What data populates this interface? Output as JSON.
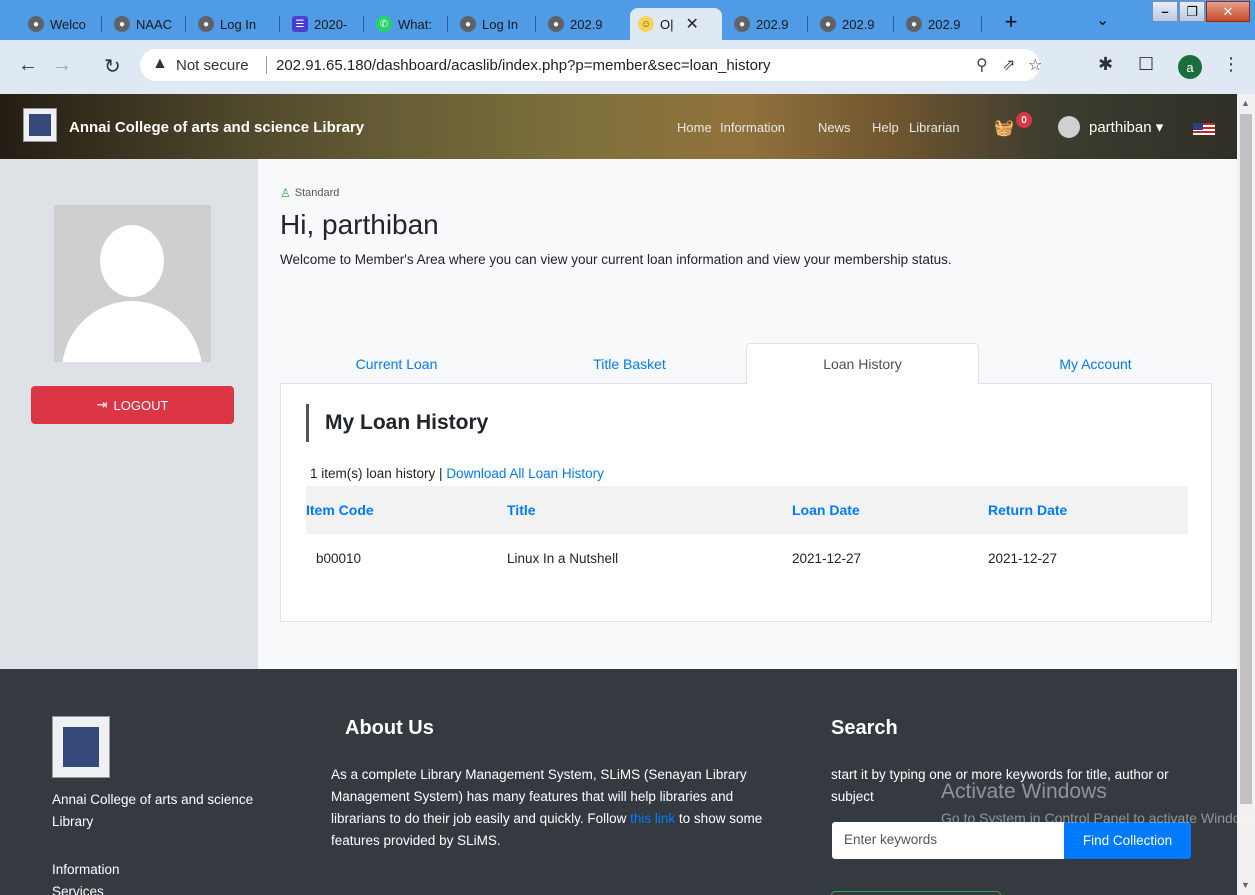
{
  "browser": {
    "tabs": [
      {
        "label": "Welco",
        "icon": "globe-icon"
      },
      {
        "label": "NAAC",
        "icon": "globe-icon"
      },
      {
        "label": "Log In",
        "icon": "globe-icon"
      },
      {
        "label": "2020-",
        "icon": "sheet-icon"
      },
      {
        "label": "What:",
        "icon": "whatsapp-icon"
      },
      {
        "label": "Log In",
        "icon": "globe-icon"
      },
      {
        "label": "202.9",
        "icon": "globe-icon"
      },
      {
        "label": "O|",
        "icon": "smile-icon"
      },
      {
        "label": "202.9",
        "icon": "globe-icon"
      },
      {
        "label": "202.9",
        "icon": "globe-icon"
      },
      {
        "label": "202.9",
        "icon": "globe-icon"
      }
    ],
    "security_label": "Not secure",
    "url": "202.91.65.180/dashboard/acaslib/index.php?p=member&sec=loan_history",
    "profile_initial": "a"
  },
  "header": {
    "brand": "Annai College of arts and science Library",
    "nav": [
      "Home",
      "Information",
      "News",
      "Help",
      "Librarian"
    ],
    "basket_count": "0",
    "username": "parthiban"
  },
  "sidebar": {
    "logout_label": "LOGOUT"
  },
  "member": {
    "type": "Standard",
    "greeting": "Hi, parthiban",
    "welcome": "Welcome to Member's Area where you can view your current loan information and view your membership status."
  },
  "tabs": [
    {
      "label": "Current Loan"
    },
    {
      "label": "Title Basket"
    },
    {
      "label": "Loan History"
    },
    {
      "label": "My Account"
    }
  ],
  "loan_history": {
    "title": "My Loan History",
    "count_text": "1 item(s) loan history | ",
    "download_label": "Download All Loan History",
    "columns": [
      "Item Code",
      "Title",
      "Loan Date",
      "Return Date"
    ],
    "rows": [
      [
        "b00010",
        "Linux In a Nutshell",
        "2021-12-27",
        "2021-12-27"
      ]
    ]
  },
  "footer": {
    "library_name": "Annai College of arts and science Library",
    "links": [
      "Information",
      "Services"
    ],
    "about_title": "About Us",
    "about_text_1": "As a complete Library Management System, SLiMS (Senayan Library Management System) has many features that will help libraries and librarians to do their job easily and quickly. Follow ",
    "about_link": "this link",
    "about_text_2": " to show some features provided by SLiMS.",
    "search_title": "Search",
    "search_desc": "start it by typing one or more keywords for title, author or subject",
    "search_placeholder": "Enter keywords",
    "search_button": "Find Collection"
  },
  "os_watermark": {
    "line1": "Activate Windows",
    "line2": "Go to System in Control Panel to activate Windows."
  }
}
